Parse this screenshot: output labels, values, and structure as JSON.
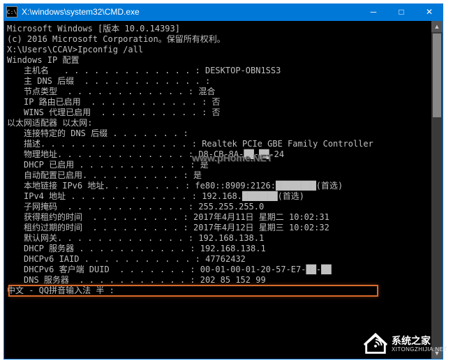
{
  "window": {
    "title": "X:\\windows\\system32\\CMD.exe",
    "icon_glyph": "C:\\"
  },
  "controls": {
    "minimize": "─",
    "maximize": "□",
    "close": "✕"
  },
  "banner": {
    "line1": "Microsoft Windows [版本 10.0.14393]",
    "line2": "(c) 2016 Microsoft Corporation。保留所有权利。"
  },
  "prompt": "X:\\Users\\CCAV>Ipconfig /all",
  "sections": {
    "ipcfg_title": "Windows IP 配置",
    "adapter_title": "以太网适配器 以太网:",
    "ime_line": "中文 - QQ拼音输入法 半 :"
  },
  "host": [
    {
      "label": "主机名",
      "dots": "   . . . . . . . . . . . . . : ",
      "value": "DESKTOP-OBN1SS3"
    },
    {
      "label": "主 DNS 后缀",
      "dots": "  . . . . . . . . . . . . : ",
      "value": ""
    },
    {
      "label": "节点类型",
      "dots": "  . . . . . . . . . . . . : ",
      "value": "混合"
    },
    {
      "label": "IP 路由已启用",
      "dots": "  . . . . . . . . . . . : ",
      "value": "否"
    },
    {
      "label": "WINS 代理已启用",
      "dots": "  . . . . . . . . . . : ",
      "value": "否"
    }
  ],
  "adapter": [
    {
      "label": "连接特定的 DNS 后缀",
      "dots": " . . . . . . . : ",
      "value": ""
    },
    {
      "label": "描述",
      "dots": ". . . . . . . . . . . . . . . : ",
      "value": "Realtek PCIe GBE Family Controller"
    },
    {
      "label": "物理地址",
      "dots": ". . . . . . . . . . . . . : ",
      "value": "D8-CB-8A-██-██-24"
    },
    {
      "label": "DHCP 已启用",
      "dots": " . . . . . . . . . . . : ",
      "value": "是"
    },
    {
      "label": "自动配置已启用",
      "dots": ". . . . . . . . . . : ",
      "value": "是"
    },
    {
      "label": "本地链接 IPv6 地址",
      "dots": ". . . . . . . . : ",
      "value": "fe80::8909:2126:████████(首选)"
    },
    {
      "label": "IPv4 地址",
      "dots": " . . . . . . . . . . . . : ",
      "value": "192.168.███████(首选)"
    },
    {
      "label": "子网掩码",
      "dots": "  . . . . . . . . . . . . : ",
      "value": "255.255.255.0"
    },
    {
      "label": "获得租约的时间",
      "dots": "  . . . . . . . . . : ",
      "value": "2017年4月11日 星期二 10:02:31"
    },
    {
      "label": "租约过期的时间",
      "dots": "  . . . . . . . . . : ",
      "value": "2017年4月12日 星期三 10:02:32"
    },
    {
      "label": "默认网关",
      "dots": ". . . . . . . . . . . . . : ",
      "value": "192.168.138.1"
    },
    {
      "label": "DHCP 服务器",
      "dots": " . . . . . . . . . . . : ",
      "value": "192.168.138.1"
    },
    {
      "label": "DHCPv6 IAID",
      "dots": " . . . . . . . . . . . : ",
      "value": "47762432"
    },
    {
      "label": "DHCPv6 客户端 DUID",
      "dots": "  . . . . . . . : ",
      "value": "00-01-00-01-20-57-E7-██-██"
    },
    {
      "label": "DNS 服务器",
      "dots": "  . . . . . . . . . . . : ",
      "value": "202 85 152 99"
    }
  ],
  "watermarks": {
    "phome": "www.pHome.NET",
    "xtzj_title": "系统之家",
    "xtzj_sub": "XITONGZHIJIA.NET"
  }
}
